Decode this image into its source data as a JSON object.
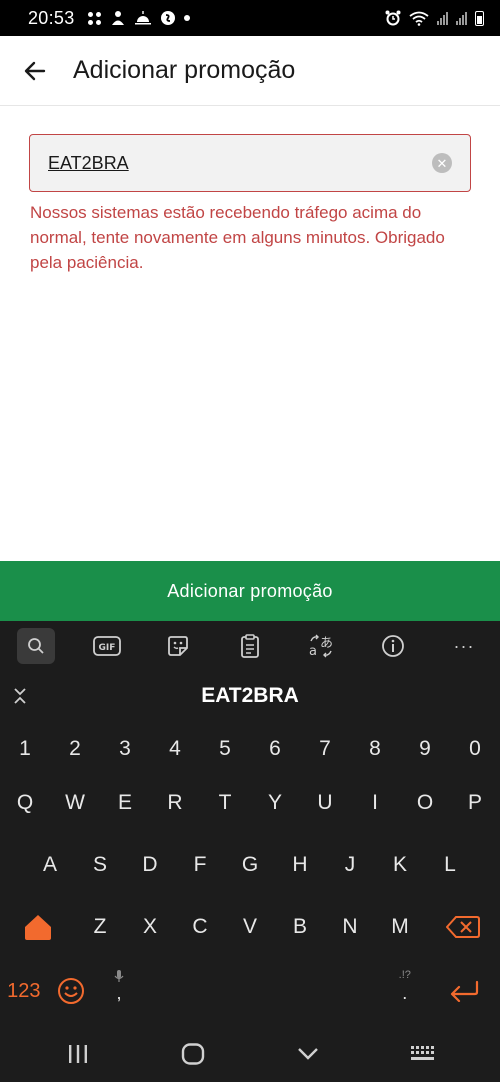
{
  "status_bar": {
    "time": "20:53",
    "icons_left": [
      "grid-icon",
      "person-up-icon",
      "sunrise-icon",
      "shazam-icon",
      "dot-icon"
    ],
    "icons_right": [
      "alarm-icon",
      "wifi-icon",
      "signal-icon",
      "signal-icon",
      "battery-icon"
    ]
  },
  "app_bar": {
    "title": "Adicionar promoção",
    "back_icon": "arrow-left-icon"
  },
  "promo_field": {
    "value": "EAT2BRA",
    "clear_icon": "clear-circle-icon"
  },
  "error_message": "Nossos sistemas estão recebendo tráfego acima do normal, tente novamente em alguns minutos. Obrigado pela paciência.",
  "submit_button": {
    "label": "Adicionar promoção",
    "color": "#1a8f4a"
  },
  "colors": {
    "error": "#c14545",
    "keyboard_accent": "#f26a2e",
    "keyboard_bg": "#1c1c1c"
  },
  "keyboard": {
    "toolbar": [
      "search-icon",
      "gif-icon",
      "sticker-icon",
      "clipboard-icon",
      "translate-icon",
      "info-icon",
      "more-icon"
    ],
    "gif_label": "GIF",
    "more_label": "···",
    "suggestion": "EAT2BRA",
    "row_numbers": [
      "1",
      "2",
      "3",
      "4",
      "5",
      "6",
      "7",
      "8",
      "9",
      "0"
    ],
    "row_q": [
      "Q",
      "W",
      "E",
      "R",
      "T",
      "Y",
      "U",
      "I",
      "O",
      "P"
    ],
    "row_a": [
      "A",
      "S",
      "D",
      "F",
      "G",
      "H",
      "J",
      "K",
      "L"
    ],
    "row_z": [
      "Z",
      "X",
      "C",
      "V",
      "B",
      "N",
      "M"
    ],
    "bottom": {
      "sym_label": "123",
      "comma": ",",
      "period": ".",
      "period_hint": ".!?"
    }
  },
  "nav_bar": [
    "recents-icon",
    "home-icon",
    "back-chevron-icon",
    "keyboard-icon"
  ]
}
